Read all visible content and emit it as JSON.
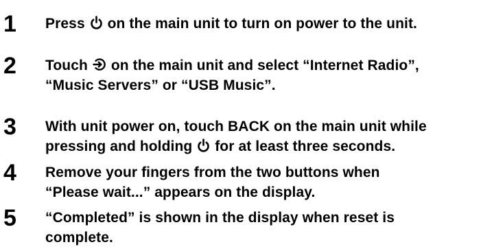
{
  "steps": [
    {
      "number": "1",
      "text_before_icon": "Press",
      "icon": "power-icon",
      "text_after_icon": "on the main unit to turn on power to the unit."
    },
    {
      "number": "2",
      "text_before_icon": "Touch",
      "icon": "input-source-icon",
      "text_after_icon_line1": "on the main unit and select “Internet Radio”,",
      "line2": "“Music Servers” or “USB Music”."
    },
    {
      "number": "3",
      "line1": "With unit power on, touch BACK on the main unit while",
      "line2_before_icon": "pressing and holding",
      "icon": "power-icon",
      "line2_after_icon": "for at least three seconds."
    },
    {
      "number": "4",
      "line1": "Remove your fingers from the two buttons when",
      "line2": "“Please wait...” appears on the display."
    },
    {
      "number": "5",
      "line1": "“Completed” is shown in the display when reset is",
      "line2": "complete."
    }
  ]
}
